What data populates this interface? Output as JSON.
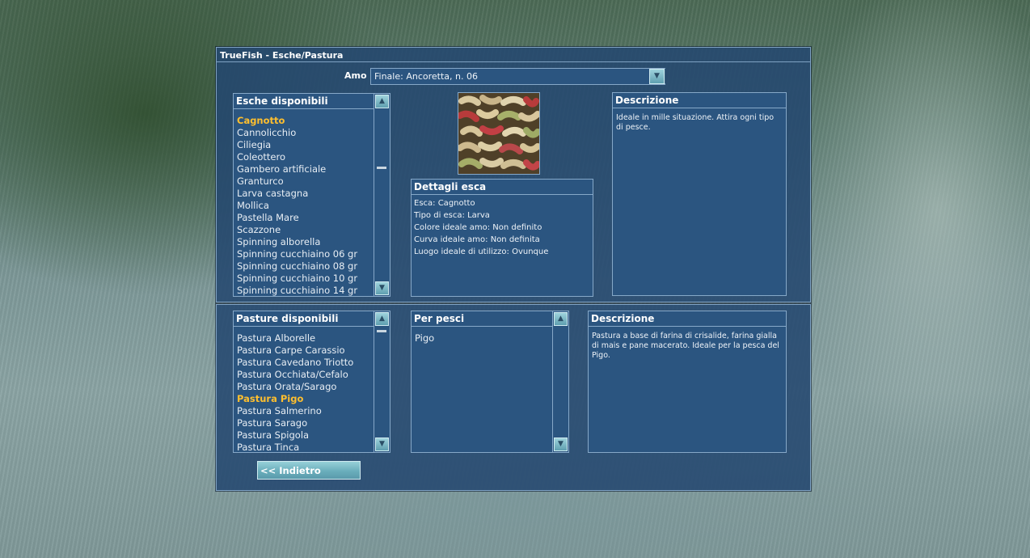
{
  "window": {
    "title": "TrueFish - Esche/Pastura"
  },
  "hook": {
    "label": "Amo",
    "value": "Finale: Ancoretta, n. 06"
  },
  "baits": {
    "header": "Esche disponibili",
    "items": [
      "Cagnotto",
      "Cannolicchio",
      "Ciliegia",
      "Coleottero",
      "Gambero artificiale",
      "Granturco",
      "Larva castagna",
      "Mollica",
      "Pastella Mare",
      "Scazzone",
      "Spinning alborella",
      "Spinning cucchiaino 06 gr",
      "Spinning cucchiaino 08 gr",
      "Spinning cucchiaino 10 gr",
      "Spinning cucchiaino 14 gr"
    ],
    "selected": "Cagnotto"
  },
  "bait_details": {
    "header": "Dettagli esca",
    "lines": [
      "Esca: Cagnotto",
      "Tipo di esca: Larva",
      "Colore ideale amo: Non definito",
      "Curva ideale amo: Non definita",
      "Luogo ideale di utilizzo: Ovunque"
    ]
  },
  "bait_description": {
    "header": "Descrizione",
    "text": "Ideale in mille situazione. Attira ogni tipo di pesce."
  },
  "groundbaits": {
    "header": "Pasture disponibili",
    "items": [
      "Pastura Alborelle",
      "Pastura Carpe Carassio",
      "Pastura Cavedano Triotto",
      "Pastura Occhiata/Cefalo",
      "Pastura Orata/Sarago",
      "Pastura Pigo",
      "Pastura Salmerino",
      "Pastura Sarago",
      "Pastura Spigola",
      "Pastura Tinca"
    ],
    "selected": "Pastura Pigo"
  },
  "fish": {
    "header": "Per pesci",
    "items": [
      "Pigo"
    ]
  },
  "groundbait_description": {
    "header": "Descrizione",
    "text": "Pastura a base di farina di crisalide, farina gialla di mais e pane macerato. Ideale per la pesca del Pigo."
  },
  "back_button": {
    "label": "<< Indietro"
  },
  "icons": {
    "up": "chevron-up-icon",
    "down": "chevron-down-icon"
  },
  "colors": {
    "selected_item": "#ffbf2e",
    "panel": "#244870",
    "button": "#7fc0cc"
  }
}
